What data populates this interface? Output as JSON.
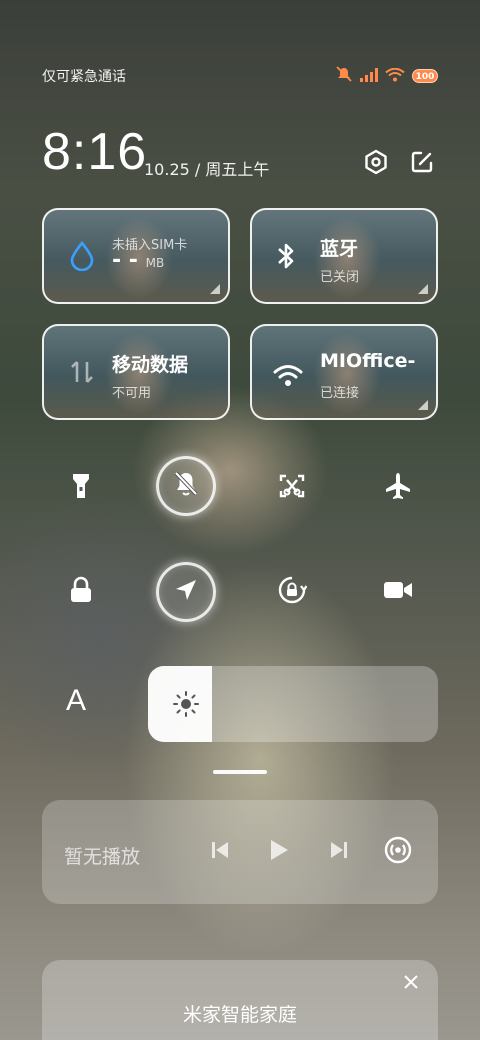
{
  "status_bar": {
    "carrier_text": "仅可紧急通话",
    "battery_level": "100",
    "icons": [
      "mute-icon",
      "signal-icon",
      "wifi-icon",
      "battery-icon"
    ]
  },
  "clock": {
    "time": "8:16",
    "date": "10.25 / 周五上午"
  },
  "header_actions": [
    {
      "icon": "settings-hex-icon"
    },
    {
      "icon": "edit-icon"
    }
  ],
  "tiles": {
    "data_usage": {
      "icon": "water-drop-icon",
      "title": "- -",
      "unit": "MB",
      "sub": "未插入SIM卡"
    },
    "bluetooth": {
      "icon": "bluetooth-icon",
      "title": "蓝牙",
      "sub": "已关闭"
    },
    "mobile_data": {
      "icon": "mobile-data-icon",
      "title": "移动数据",
      "sub": "不可用"
    },
    "wifi": {
      "icon": "wifi-icon",
      "title": "MIOffice-",
      "sub": "已连接"
    }
  },
  "toggles": [
    {
      "icon": "flashlight-icon",
      "active": false
    },
    {
      "icon": "bell-off-icon",
      "active": true
    },
    {
      "icon": "screenshot-icon",
      "active": false
    },
    {
      "icon": "airplane-icon",
      "active": false
    },
    {
      "icon": "lock-icon",
      "active": false
    },
    {
      "icon": "location-icon",
      "active": true
    },
    {
      "icon": "rotation-lock-icon",
      "active": false
    },
    {
      "icon": "video-icon",
      "active": false
    }
  ],
  "brightness": {
    "font_label": "A",
    "level_fraction": 0.22
  },
  "media": {
    "status_text": "暂无播放",
    "controls": [
      "previous-icon",
      "play-icon",
      "next-icon",
      "cast-icon"
    ]
  },
  "smart_home": {
    "title": "米家智能家庭"
  },
  "colors": {
    "battery": "#ff8a4a",
    "wifi_signal": "#ff8a4a",
    "water_drop": "#3aa0ff"
  }
}
